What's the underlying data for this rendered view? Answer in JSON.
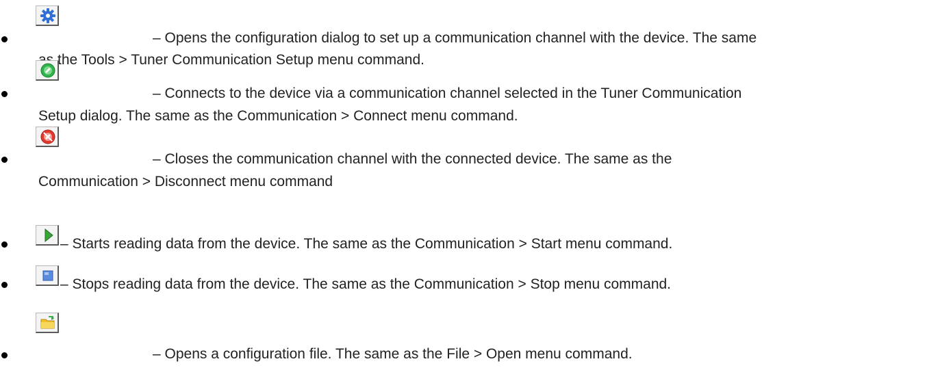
{
  "items": [
    {
      "icon": "gear-icon",
      "line1": "– Opens the configuration dialog to set up a communication channel with the device. The same",
      "line2": "as the Tools > Tuner Communication Setup menu command."
    },
    {
      "icon": "connect-icon",
      "line1": "– Connects to the device via a communication channel selected in the Tuner Communication",
      "line2": "Setup dialog. The same as the Communication > Connect menu command."
    },
    {
      "icon": "disconnect-icon",
      "line1": "– Closes the communication channel with the connected device. The same as the",
      "line2": "Communication > Disconnect menu command"
    },
    {
      "icon": "play-icon",
      "line1": "– Starts reading data from the device. The same as the Communication > Start menu command."
    },
    {
      "icon": "stop-icon",
      "line1": "– Stops reading data from the device. The same as the Communication > Stop menu command."
    },
    {
      "icon": "open-folder-icon",
      "line1": "– Opens a configuration file. The same as the File > Open menu command."
    }
  ],
  "colors": {
    "gear": "#2f6fd6",
    "connect": "#2fb34a",
    "disconnect": "#e03a2f",
    "play": "#3aa53a",
    "stop": "#5a8de0",
    "folder": "#f2c22e"
  }
}
